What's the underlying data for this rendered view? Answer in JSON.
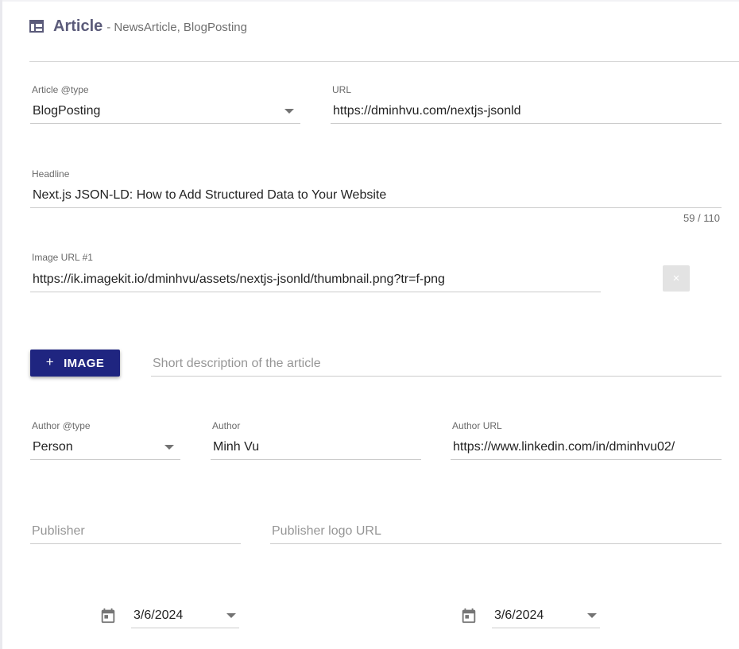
{
  "header": {
    "icon": "article-table-icon",
    "title": "Article",
    "subtitle": "- NewsArticle, BlogPosting"
  },
  "article_type": {
    "label": "Article @type",
    "value": "BlogPosting"
  },
  "url": {
    "label": "URL",
    "value": "https://dminhvu.com/nextjs-jsonld"
  },
  "headline": {
    "label": "Headline",
    "value": "Next.js JSON-LD: How to Add Structured Data to Your Website",
    "counter": "59 / 110"
  },
  "image_url_1": {
    "label": "Image URL #1",
    "value": "https://ik.imagekit.io/dminhvu/assets/nextjs-jsonld/thumbnail.png?tr=f-png",
    "remove_icon": "×"
  },
  "add_image_button": {
    "icon": "+",
    "label": "IMAGE"
  },
  "description": {
    "placeholder": "Short description of the article"
  },
  "author_type": {
    "label": "Author @type",
    "value": "Person"
  },
  "author": {
    "label": "Author",
    "value": "Minh Vu"
  },
  "author_url": {
    "label": "Author URL",
    "value": "https://www.linkedin.com/in/dminhvu02/"
  },
  "publisher": {
    "placeholder": "Publisher"
  },
  "publisher_logo": {
    "placeholder": "Publisher logo URL"
  },
  "date_published": {
    "value": "3/6/2024",
    "icon": "calendar-icon"
  },
  "date_modified": {
    "value": "3/6/2024",
    "icon": "calendar-icon"
  },
  "colors": {
    "primary": "#1f2580",
    "title": "#5b5b7a"
  }
}
